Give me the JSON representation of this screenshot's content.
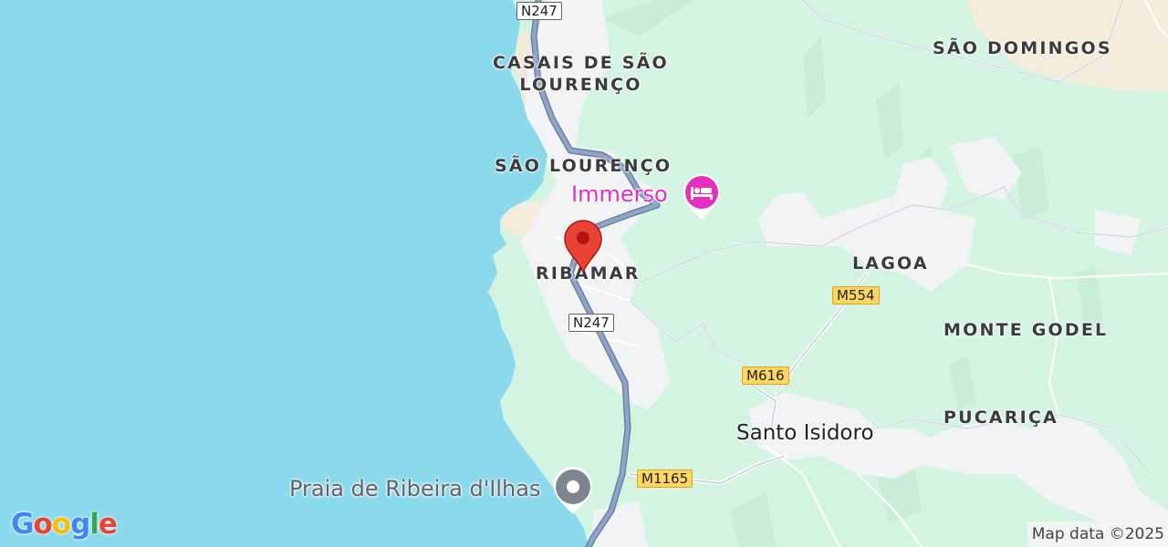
{
  "map": {
    "places": {
      "casais_line1": "CASAIS DE SÃO",
      "casais_line2": "LOURENÇO",
      "sao_domingos": "SÃO DOMINGOS",
      "sao_lourenco": "SÃO LOURENÇO",
      "ribamar": "RIBAMAR",
      "lagoa": "LAGOA",
      "monte_godel": "MONTE GODEL",
      "pucarica": "PUCARIÇA",
      "santo_isidoro": "Santo Isidoro"
    },
    "roads": {
      "n247_top": "N247",
      "n247_mid": "N247",
      "m554": "M554",
      "m616": "M616",
      "m1165": "M1165"
    },
    "pois": {
      "hotel": {
        "name": "Immerso",
        "icon": "hotel-bed-icon",
        "color": "#e52fbf"
      },
      "beach": {
        "name": "Praia de Ribeira d'Ilhas",
        "icon": "place-pin-icon",
        "color": "#7c8590"
      }
    },
    "marker": {
      "icon": "red-location-pin-icon",
      "color": "#ea4335"
    },
    "colors": {
      "water": "#8ad9ec",
      "land": "#d4f4e2",
      "urban": "#f1f3f4",
      "highway": "#8ea4c8",
      "sand": "#f5ecdc"
    }
  },
  "branding": {
    "logo_letters": [
      "G",
      "o",
      "o",
      "g",
      "l",
      "e"
    ],
    "logo_colors": [
      "#4285f4",
      "#ea4335",
      "#fbbc05",
      "#4285f4",
      "#34a853",
      "#ea4335"
    ],
    "attribution": "Map data ©2025"
  }
}
